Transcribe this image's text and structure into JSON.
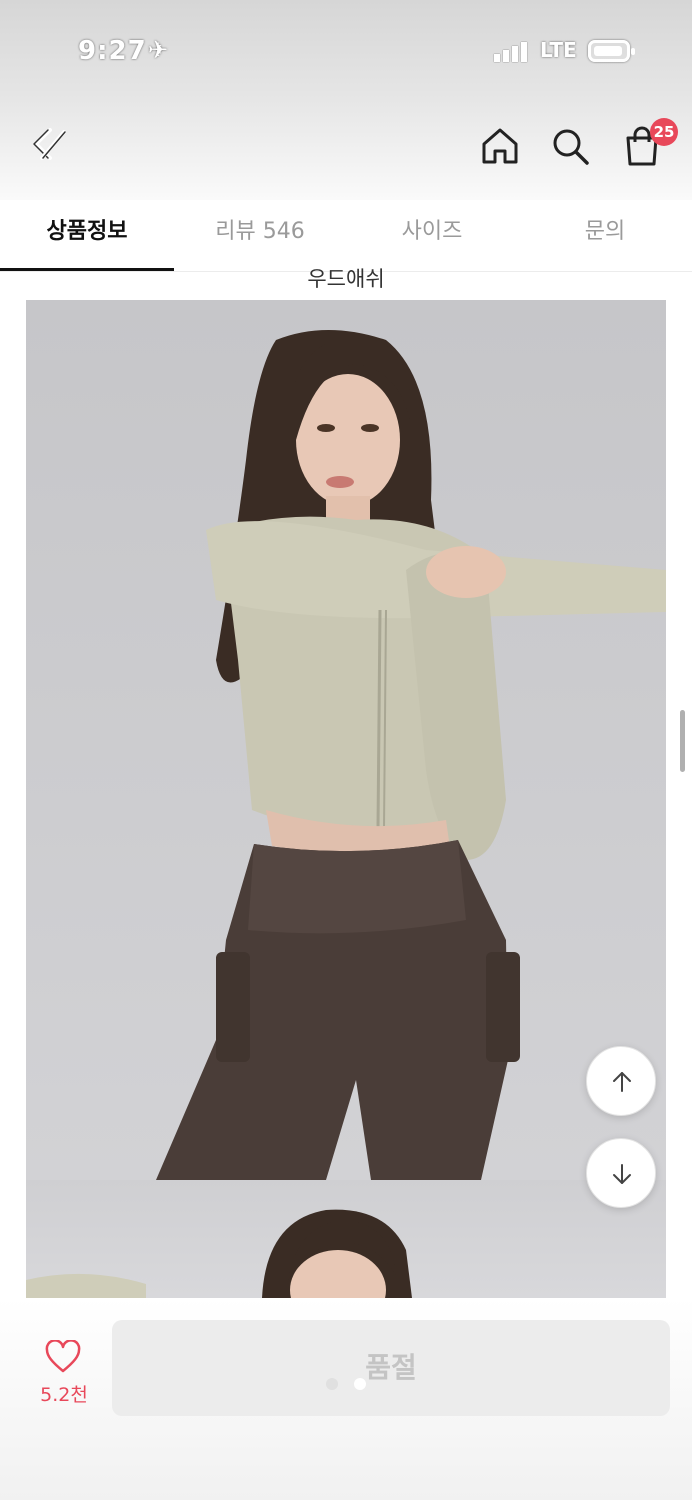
{
  "status_bar": {
    "time": "9:27",
    "network": "LTE",
    "icons": [
      "airplane-icon",
      "signal-icon",
      "battery-icon"
    ]
  },
  "top_nav": {
    "icons": [
      "back-icon",
      "home-icon",
      "search-icon",
      "shopping-bag-icon"
    ],
    "cart_count": "25"
  },
  "tabs": [
    {
      "label": "상품정보",
      "active": true
    },
    {
      "label": "리뷰 546",
      "active": false
    },
    {
      "label": "사이즈",
      "active": false
    },
    {
      "label": "문의",
      "active": false
    }
  ],
  "content": {
    "peek_text": "우드애쉬",
    "images": [
      "product-photo-model-stretching",
      "product-photo-model-partial"
    ]
  },
  "floating_controls": {
    "icons": [
      "arrow-up-icon",
      "arrow-down-icon"
    ]
  },
  "bottom_bar": {
    "like_count": "5.2천",
    "purchase_button_label": "품절"
  },
  "colors": {
    "accent": "#e8485a",
    "top_color": "#c9c7b3",
    "legging_color": "#4a3d38",
    "disabled_button": "#ececec"
  }
}
